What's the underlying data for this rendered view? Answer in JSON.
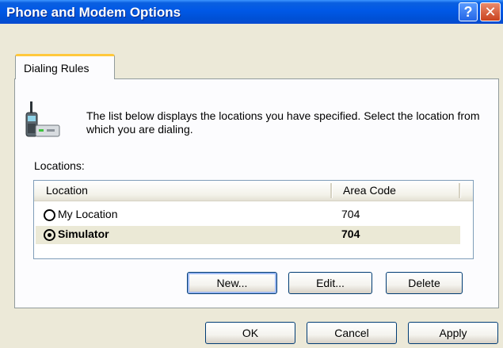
{
  "window": {
    "title": "Phone and Modem Options",
    "help_glyph": "?",
    "close_glyph": "✕"
  },
  "tabs": [
    {
      "label": "Dialing Rules",
      "active": true
    }
  ],
  "dialing_rules": {
    "icon": "phone-modem-icon",
    "description": "The list below displays the locations you have specified. Select the location from which you are dialing.",
    "locations_label": "Locations:",
    "columns": [
      "Location",
      "Area Code"
    ],
    "rows": [
      {
        "name": "My Location",
        "area_code": "704",
        "selected": false
      },
      {
        "name": "Simulator",
        "area_code": "704",
        "selected": true
      }
    ],
    "buttons": {
      "new": "New...",
      "edit": "Edit...",
      "delete": "Delete"
    }
  },
  "footer": {
    "ok": "OK",
    "cancel": "Cancel",
    "apply": "Apply"
  },
  "colors": {
    "titlebar": "#0058e6",
    "dialog_bg": "#ece9d8",
    "selected_row": "#ebe9d6",
    "close_button": "#c9421e"
  }
}
